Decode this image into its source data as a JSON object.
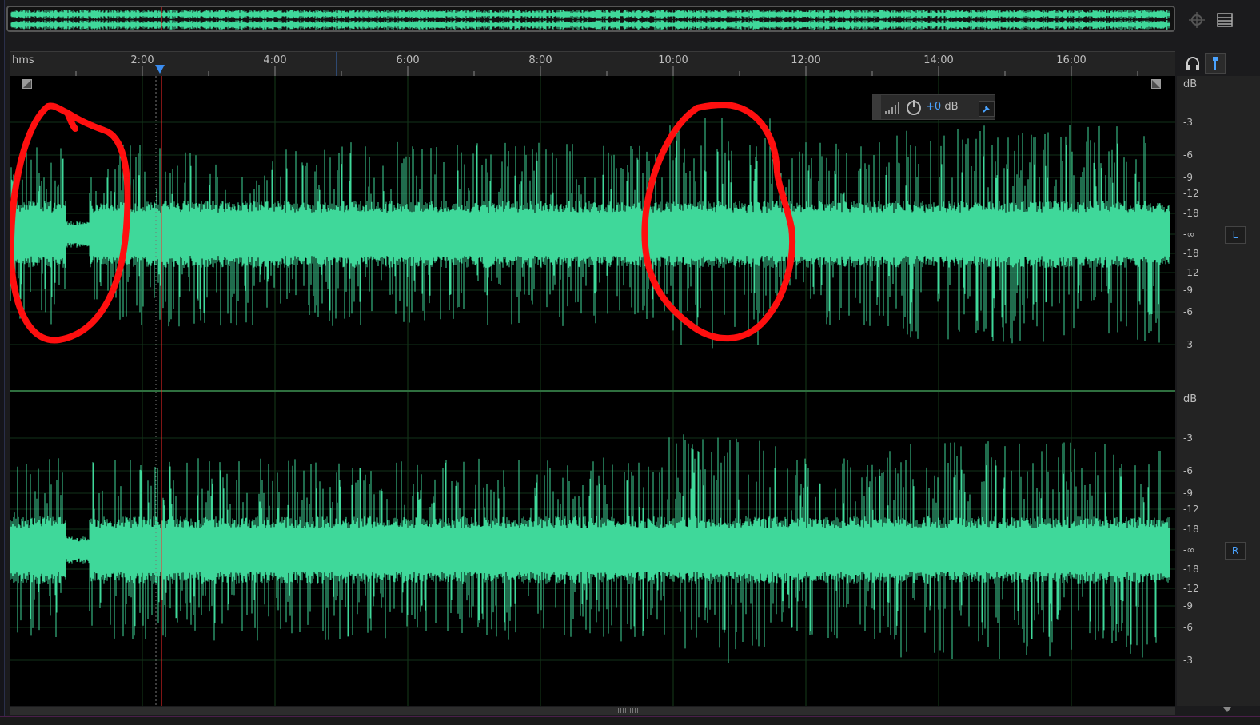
{
  "ruler": {
    "unit_label": "hms",
    "ticks": [
      "2:00",
      "4:00",
      "6:00",
      "8:00",
      "10:00",
      "12:00",
      "14:00",
      "16:00"
    ]
  },
  "scale": {
    "unit_label": "dB",
    "labels": [
      "-3",
      "-6",
      "-9",
      "-12",
      "-18",
      "-∞",
      "-18",
      "-12",
      "-9",
      "-6",
      "-3"
    ]
  },
  "channels": {
    "left_label": "L",
    "right_label": "R"
  },
  "hud": {
    "value": "+0",
    "unit": "dB"
  },
  "colors": {
    "waveform": "#3fd89a",
    "annotation": "#ff1010",
    "playhead": "#ff2a2a",
    "accent": "#4aa3ff"
  },
  "icons": {
    "overview_zoom": "zoom-icon",
    "menu": "menu-icon",
    "headphones": "headphones-icon",
    "marker": "marker-pin-icon",
    "power": "power-icon",
    "pin": "pin-icon"
  }
}
